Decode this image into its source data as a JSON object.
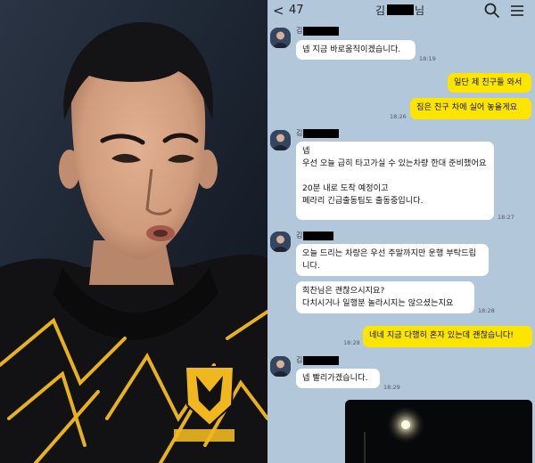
{
  "topbar": {
    "back_glyph": "<",
    "back_count": "47",
    "title_prefix": "김",
    "title_suffix": "님",
    "icons": [
      "search-icon",
      "menu-icon"
    ]
  },
  "colors": {
    "chat_background": "#b2c7da",
    "incoming_bubble": "#ffffff",
    "outgoing_bubble": "#fee500"
  },
  "messages": [
    {
      "sender_initial": "김",
      "text": "넵 지금 바로움직이겠습니다.",
      "time": "18:19"
    },
    {
      "text": "일단 제 친구들 와서"
    },
    {
      "text": "짐은 친구 차에 실어 놓을게요",
      "time": "18:26"
    },
    {
      "sender_initial": "김",
      "text": "넵\n우선 오늘 급히 타고가실 수 있는차량 한대 준비했어요\n\n20분 내로 도착 예정이고\n페라리 긴급출동팀도 출동중입니다.",
      "time": "18:27"
    },
    {
      "sender_initial": "김",
      "text": "오늘 드리는 차량은 우선 주말까지만 운행 부탁드립니다."
    },
    {
      "text": "희찬님은 괜찮으시지요?\n다치시거나 일행분 놀라시지는 않으셨는지요",
      "time": "18:28"
    },
    {
      "text": "네네 지금 다행히 혼자 있는데 괜찮습니다!",
      "time": "18:28"
    },
    {
      "sender_initial": "김",
      "text": "넵 빨리가겠습니다.",
      "time": "18:29"
    }
  ]
}
